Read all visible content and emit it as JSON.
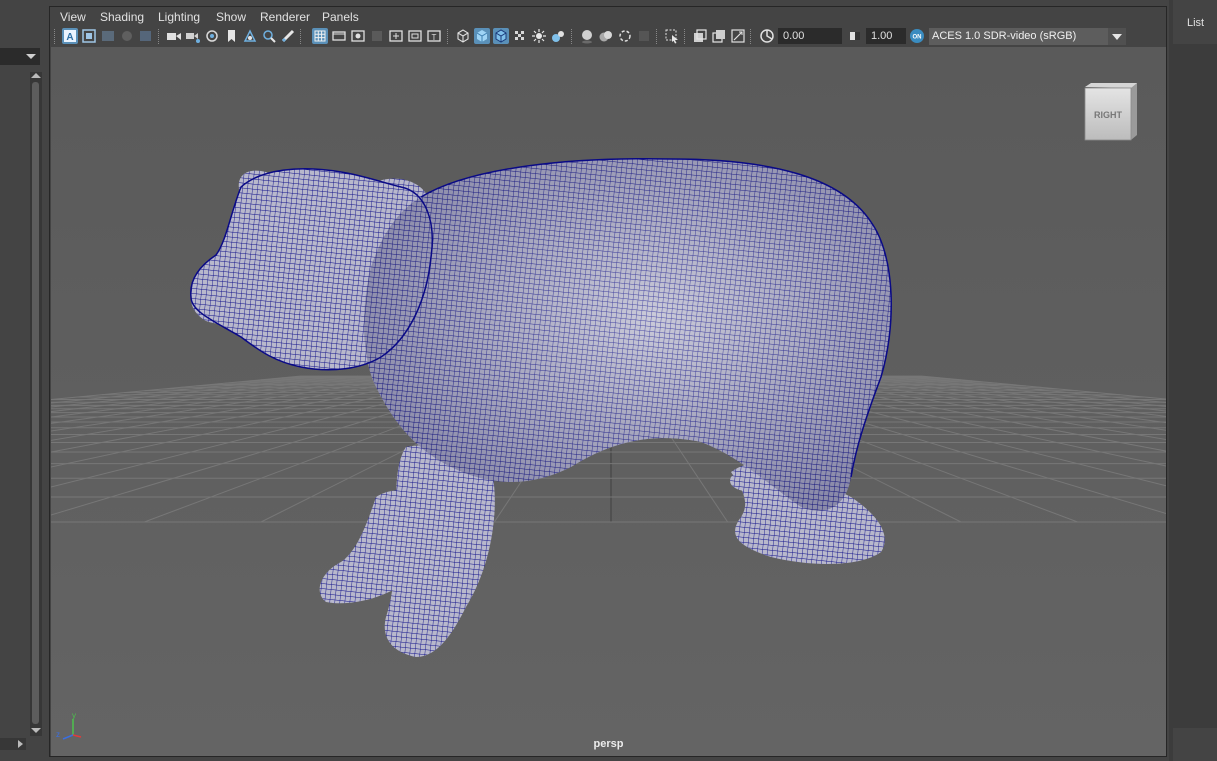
{
  "menu": [
    "View",
    "Shading",
    "Lighting",
    "Show",
    "Renderer",
    "Panels"
  ],
  "toolbar": {
    "exposure_value": "0.00",
    "gamma_value": "1.00",
    "color_space": "ACES 1.0 SDR-video (sRGB)",
    "icons": [
      "select-camera-icon",
      "camera-attributes-icon",
      "bookmark-icon",
      "image-plane-icon",
      "2d-pan-zoom-icon",
      "grease-pencil-icon",
      "grid-icon",
      "film-gate-icon",
      "resolution-gate-icon",
      "gate-mask-icon",
      "field-chart-icon",
      "safe-action-icon",
      "safe-title-icon",
      "wireframe-icon",
      "smooth-shade-icon",
      "wireframe-on-shaded-icon",
      "xray-icon",
      "textured-icon",
      "use-all-lights-icon",
      "shadows-icon",
      "ambient-occlusion-icon",
      "motion-blur-icon",
      "anti-aliasing-icon",
      "isolate-select-icon",
      "xray-joints-icon",
      "xray-active-components-icon",
      "backface-culling-icon",
      "exposure-icon",
      "gamma-icon",
      "color-management-icon"
    ]
  },
  "viewport": {
    "camera": "persp",
    "view_cube_label": "RIGHT",
    "object": "bear wireframe-on-shaded mesh",
    "wire_color": "#0a0a86",
    "grid_color": "#7a7a7a",
    "axis_labels": [
      "y",
      "z"
    ]
  },
  "right_panel": {
    "label": "List"
  }
}
